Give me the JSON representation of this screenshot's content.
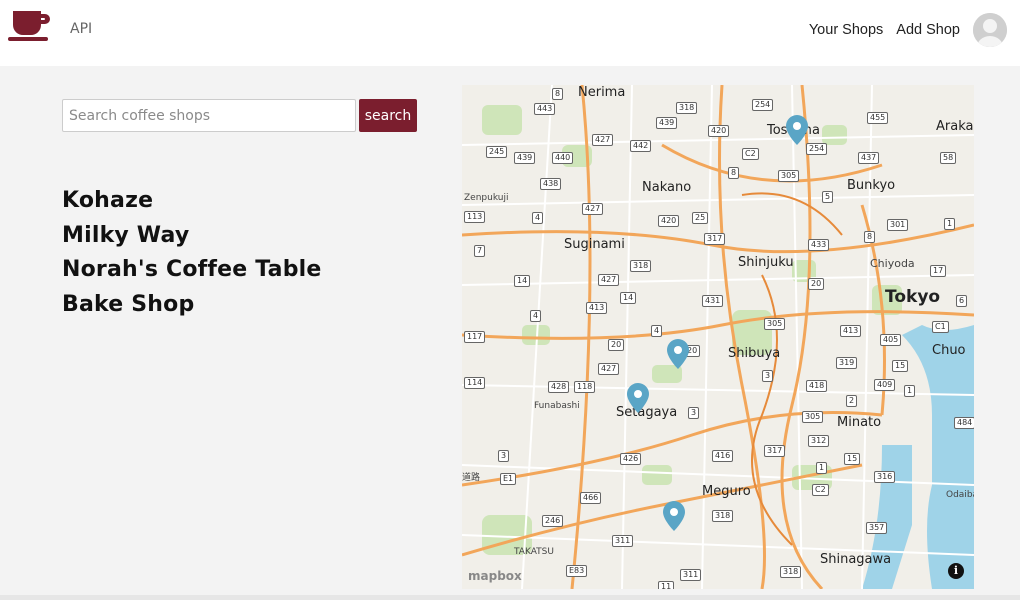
{
  "navbar": {
    "api_label": "API",
    "your_shops_label": "Your Shops",
    "add_shop_label": "Add Shop",
    "brand_color": "#7b1e2e"
  },
  "search": {
    "placeholder": "Search coffee shops",
    "value": "",
    "button_label": "search"
  },
  "shops": [
    "Kohaze",
    "Milky Way",
    "Norah's Coffee Table",
    "Bake Shop"
  ],
  "map": {
    "attribution": "mapbox",
    "info_icon": "i",
    "labels": {
      "nerima": "Nerima",
      "toshima": "Toshima",
      "arakawa": "Araka",
      "nakano": "Nakano",
      "bunkyo": "Bunkyo",
      "zenpukuji": "Zenpukuji",
      "suginami": "Suginami",
      "shinjuku": "Shinjuku",
      "chiyoda": "Chiyoda",
      "tokyo": "Tokyo",
      "chuo": "Chuo",
      "shibuya": "Shibuya",
      "funabashi": "Funabashi",
      "setagaya": "Setagaya",
      "minato": "Minato",
      "meguro": "Meguro",
      "odaiba": "Odaiba",
      "takatsu": "TAKATSU",
      "shinagawa": "Shinagawa",
      "road": "道路"
    },
    "shields": [
      "8",
      "443",
      "318",
      "254",
      "455",
      "439",
      "420",
      "427",
      "442",
      "C2",
      "254",
      "437",
      "58",
      "245",
      "439",
      "440",
      "305",
      "8",
      "438",
      "5",
      "427",
      "4",
      "420",
      "25",
      "301",
      "1",
      "317",
      "433",
      "7",
      "318",
      "427",
      "14",
      "20",
      "413",
      "14",
      "431",
      "4",
      "305",
      "117",
      "20",
      "4",
      "20",
      "405",
      "427",
      "319",
      "15",
      "428",
      "118",
      "418",
      "409",
      "2",
      "1",
      "305",
      "312",
      "3",
      "426",
      "416",
      "317",
      "1",
      "15",
      "E1",
      "316",
      "466",
      "C2",
      "246",
      "318",
      "311",
      "357",
      "E83",
      "311",
      "318",
      "11",
      "484",
      "C1",
      "6",
      "17",
      "3",
      "8",
      "113",
      "114",
      "413",
      "3"
    ],
    "pin_color": "#5aa5c6",
    "water_color": "#9fd3e8",
    "park_color": "#cfe5b9",
    "road_color": "#f2a65a"
  }
}
